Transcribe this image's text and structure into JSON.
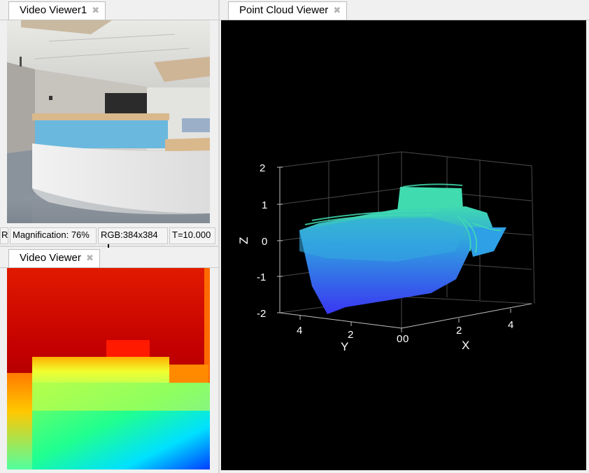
{
  "video_viewer1": {
    "tab_label": "Video Viewer1",
    "close_glyph": "✖",
    "status": {
      "cut": "R",
      "magnification": "Magnification: 76%",
      "dims": "RGB:384x384",
      "time": "T=10.000"
    }
  },
  "video_viewer": {
    "tab_label": "Video Viewer",
    "close_glyph": "✖"
  },
  "point_cloud_viewer": {
    "tab_label": "Point Cloud Viewer",
    "close_glyph": "✖",
    "axes": {
      "z_label": "Z",
      "y_label": "Y",
      "x_label": "X",
      "z_ticks": [
        "2",
        "1",
        "0",
        "-1",
        "-2"
      ],
      "y_ticks": [
        "4",
        "2",
        "0"
      ],
      "x_ticks": [
        "0",
        "2",
        "4"
      ]
    }
  },
  "colors": {
    "background": "#f0f0f0",
    "plot_background": "#000000",
    "axis_color": "#bfbfbf",
    "cloud_top": "#3fd7b0",
    "cloud_bottom": "#3b3ff0"
  }
}
